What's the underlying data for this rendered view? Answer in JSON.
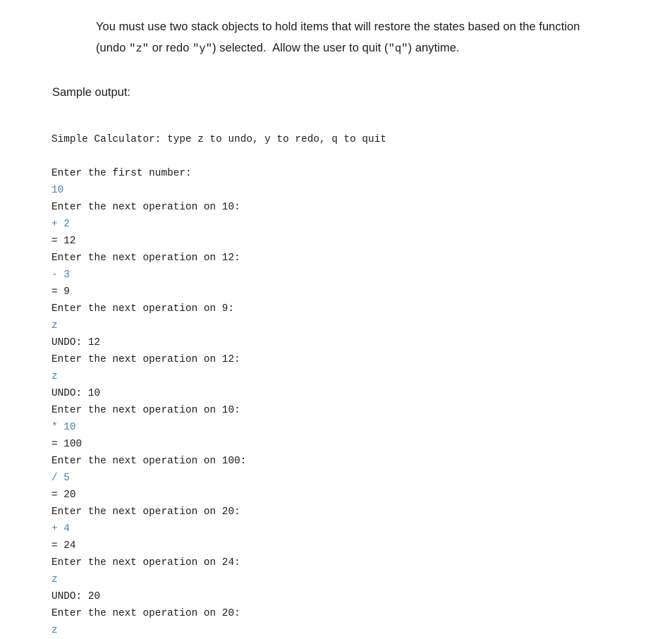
{
  "colors": {
    "page_background": "#ffffff",
    "body_text": "#1c1c1c",
    "user_input_blue": "#4a7ebb"
  },
  "prose": {
    "segments": [
      {
        "type": "text",
        "text": "You must use two stack objects to hold items that will restore the states based on the function (undo "
      },
      {
        "type": "mono",
        "text": "\"z\""
      },
      {
        "type": "text",
        "text": " or redo "
      },
      {
        "type": "mono",
        "text": "\"y\""
      },
      {
        "type": "text",
        "text": ") selected.  Allow the user to quit ("
      },
      {
        "type": "mono",
        "text": "\"q\""
      },
      {
        "type": "text",
        "text": ") anytime."
      }
    ],
    "plain_text": "You must use two stack objects to hold items that will restore the states based on the function (undo \"z\" or redo \"y\") selected.  Allow the user to quit (\"q\") anytime."
  },
  "sample_output_label": "Sample output:",
  "console": {
    "lines": [
      {
        "kind": "out",
        "text": "Simple Calculator: type z to undo, y to redo, q to quit"
      },
      {
        "kind": "blank",
        "text": ""
      },
      {
        "kind": "out",
        "text": "Enter the first number:"
      },
      {
        "kind": "in",
        "text": "10"
      },
      {
        "kind": "out",
        "text": "Enter the next operation on 10:"
      },
      {
        "kind": "in",
        "text": "+ 2"
      },
      {
        "kind": "out",
        "text": "= 12"
      },
      {
        "kind": "out",
        "text": "Enter the next operation on 12:"
      },
      {
        "kind": "in",
        "text": "- 3"
      },
      {
        "kind": "out",
        "text": "= 9"
      },
      {
        "kind": "out",
        "text": "Enter the next operation on 9:"
      },
      {
        "kind": "in",
        "text": "z"
      },
      {
        "kind": "out",
        "text": "UNDO: 12"
      },
      {
        "kind": "out",
        "text": "Enter the next operation on 12:"
      },
      {
        "kind": "in",
        "text": "z"
      },
      {
        "kind": "out",
        "text": "UNDO: 10"
      },
      {
        "kind": "out",
        "text": "Enter the next operation on 10:"
      },
      {
        "kind": "in",
        "text": "* 10"
      },
      {
        "kind": "out",
        "text": "= 100"
      },
      {
        "kind": "out",
        "text": "Enter the next operation on 100:"
      },
      {
        "kind": "in",
        "text": "/ 5"
      },
      {
        "kind": "out",
        "text": "= 20"
      },
      {
        "kind": "out",
        "text": "Enter the next operation on 20:"
      },
      {
        "kind": "in",
        "text": "+ 4"
      },
      {
        "kind": "out",
        "text": "= 24"
      },
      {
        "kind": "out",
        "text": "Enter the next operation on 24:"
      },
      {
        "kind": "in",
        "text": "z"
      },
      {
        "kind": "out",
        "text": "UNDO: 20"
      },
      {
        "kind": "out",
        "text": "Enter the next operation on 20:"
      },
      {
        "kind": "in",
        "text": "z"
      }
    ]
  }
}
